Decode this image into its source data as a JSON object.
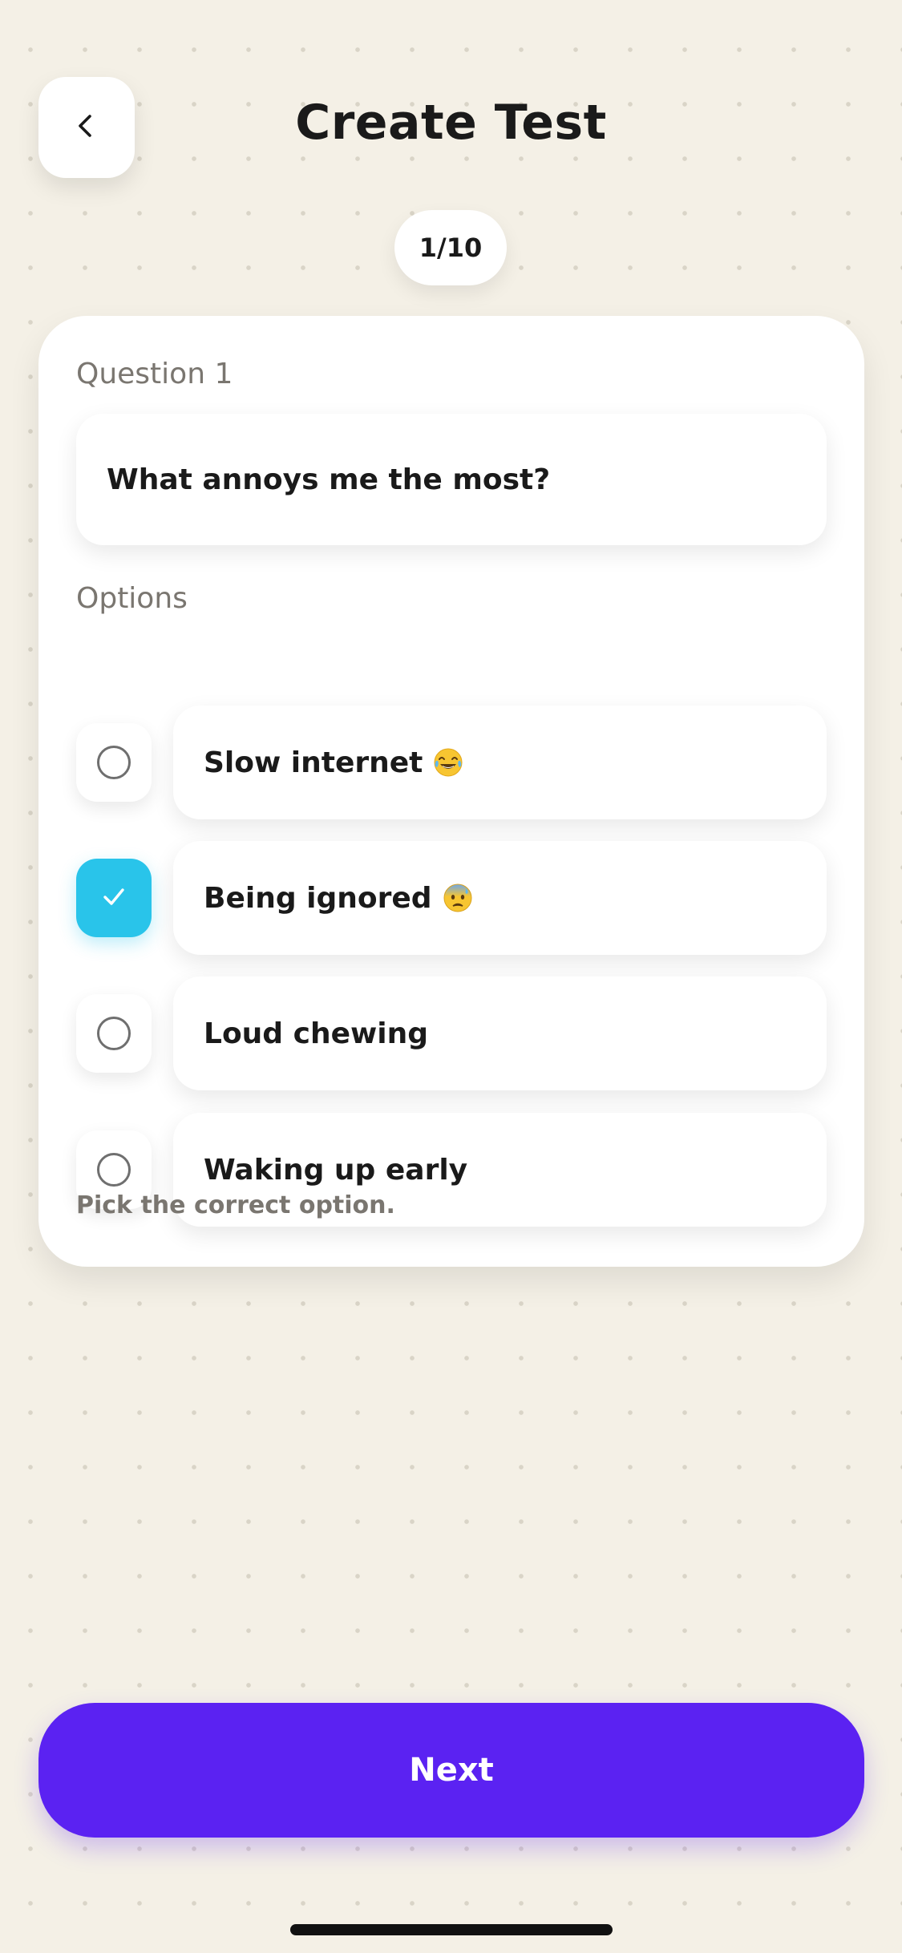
{
  "header": {
    "title": "Create Test",
    "back_icon": "chevron-left-icon"
  },
  "progress": {
    "label": "1/10",
    "current": 1,
    "total": 10
  },
  "question": {
    "label": "Question 1",
    "text": "What annoys me the most?"
  },
  "options": {
    "label": "Options",
    "items": [
      {
        "text": "Slow internet",
        "emoji": "😂",
        "emoji_name": "tears-of-joy-emoji",
        "selected": false
      },
      {
        "text": "Being ignored",
        "emoji": "😰",
        "emoji_name": "anxious-sweat-emoji",
        "selected": true
      },
      {
        "text": "Loud chewing",
        "emoji": "",
        "selected": false
      },
      {
        "text": "Waking up early",
        "emoji": "",
        "selected": false
      }
    ],
    "hint": "Pick the correct option."
  },
  "footer": {
    "next_label": "Next"
  },
  "colors": {
    "background": "#f4f0e6",
    "accent_purple": "#5b22f2",
    "checked_cyan": "#29c4ea",
    "muted_text": "#7a7670"
  }
}
